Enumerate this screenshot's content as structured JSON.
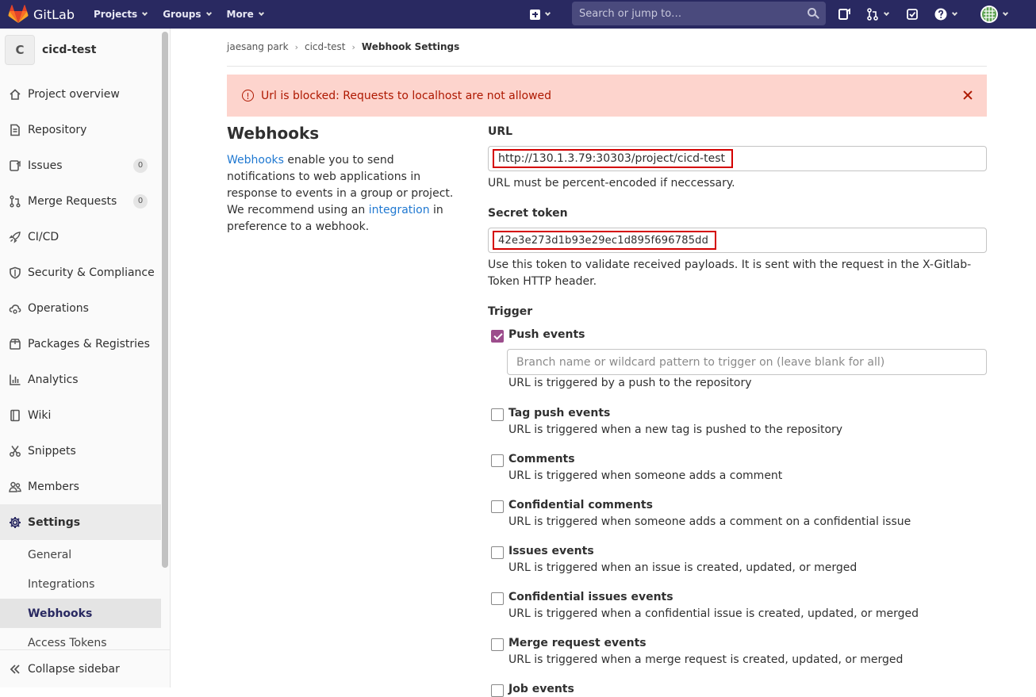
{
  "navbar": {
    "brand": "GitLab",
    "menu": [
      {
        "label": "Projects"
      },
      {
        "label": "Groups"
      },
      {
        "label": "More"
      }
    ],
    "search_placeholder": "Search or jump to…"
  },
  "sidebar": {
    "project_initial": "C",
    "project_name": "cicd-test",
    "items": [
      {
        "label": "Project overview",
        "icon": "home-icon"
      },
      {
        "label": "Repository",
        "icon": "document-icon"
      },
      {
        "label": "Issues",
        "icon": "issues-icon",
        "badge": "0"
      },
      {
        "label": "Merge Requests",
        "icon": "merge-request-icon",
        "badge": "0"
      },
      {
        "label": "CI/CD",
        "icon": "rocket-icon"
      },
      {
        "label": "Security & Compliance",
        "icon": "shield-icon"
      },
      {
        "label": "Operations",
        "icon": "cloud-gear-icon"
      },
      {
        "label": "Packages & Registries",
        "icon": "package-icon"
      },
      {
        "label": "Analytics",
        "icon": "chart-icon"
      },
      {
        "label": "Wiki",
        "icon": "book-icon"
      },
      {
        "label": "Snippets",
        "icon": "scissors-icon"
      },
      {
        "label": "Members",
        "icon": "users-icon"
      },
      {
        "label": "Settings",
        "icon": "gear-icon"
      }
    ],
    "settings_sub": [
      {
        "label": "General"
      },
      {
        "label": "Integrations"
      },
      {
        "label": "Webhooks"
      },
      {
        "label": "Access Tokens"
      }
    ],
    "collapse_label": "Collapse sidebar"
  },
  "breadcrumb": {
    "owner": "jaesang park",
    "project": "cicd-test",
    "current": "Webhook Settings"
  },
  "alert": {
    "text": "Url is blocked: Requests to localhost are not allowed"
  },
  "intro": {
    "title": "Webhooks",
    "link1": "Webhooks",
    "text1": " enable you to send notifications to web applications in response to events in a group or project. We recommend using an ",
    "link2": "integration",
    "text2": " in preference to a webhook."
  },
  "form": {
    "url_label": "URL",
    "url_value": "http://130.1.3.79:30303/project/cicd-test",
    "url_help": "URL must be percent-encoded if neccessary.",
    "token_label": "Secret token",
    "token_value": "42e3e273d1b93e29ec1d895f696785dd",
    "token_help": "Use this token to validate received payloads. It is sent with the request in the X-Gitlab-Token HTTP header.",
    "trigger_label": "Trigger",
    "branch_placeholder": "Branch name or wildcard pattern to trigger on (leave blank for all)",
    "triggers": [
      {
        "title": "Push events",
        "help": "URL is triggered by a push to the repository",
        "checked": true
      },
      {
        "title": "Tag push events",
        "help": "URL is triggered when a new tag is pushed to the repository",
        "checked": false
      },
      {
        "title": "Comments",
        "help": "URL is triggered when someone adds a comment",
        "checked": false
      },
      {
        "title": "Confidential comments",
        "help": "URL is triggered when someone adds a comment on a confidential issue",
        "checked": false
      },
      {
        "title": "Issues events",
        "help": "URL is triggered when an issue is created, updated, or merged",
        "checked": false
      },
      {
        "title": "Confidential issues events",
        "help": "URL is triggered when a confidential issue is created, updated, or merged",
        "checked": false
      },
      {
        "title": "Merge request events",
        "help": "URL is triggered when a merge request is created, updated, or merged",
        "checked": false
      },
      {
        "title": "Job events",
        "help": "",
        "checked": false
      }
    ]
  },
  "colors": {
    "navbar": "#292961",
    "alert_bg": "#fdd4cd",
    "alert_text": "#ae1800",
    "checkbox_checked": "#9c4d8c",
    "link": "#1f78d1",
    "highlight_box": "#d40000"
  }
}
